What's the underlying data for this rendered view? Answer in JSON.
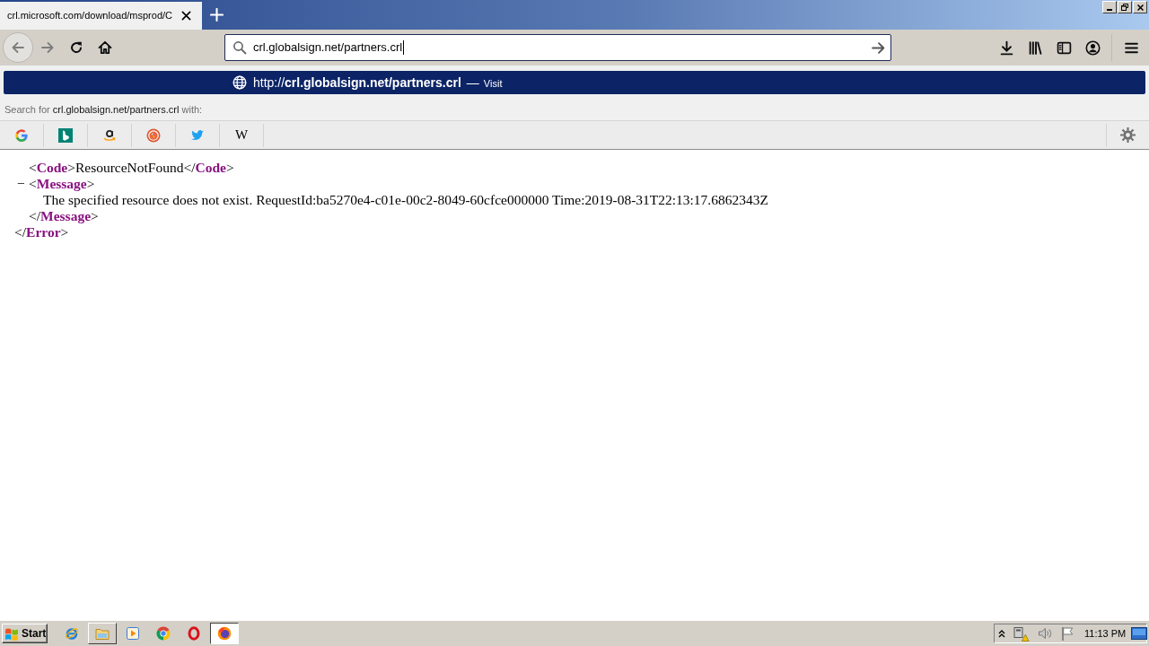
{
  "tabs": [
    {
      "label": "crl.microsoft.com/download/msprod/C",
      "selected": true
    }
  ],
  "window_controls": [
    {
      "kind": "minimize"
    },
    {
      "kind": "restore"
    },
    {
      "kind": "close"
    }
  ],
  "navigation": [
    {
      "kind": "back",
      "disabled": true
    },
    {
      "kind": "forward",
      "disabled": true
    },
    {
      "kind": "reload",
      "disabled": false
    },
    {
      "kind": "home",
      "disabled": false
    }
  ],
  "address_bar": {
    "value": "crl.globalsign.net/partners.crl",
    "focused": true
  },
  "toolbar": [
    {
      "kind": "download"
    },
    {
      "kind": "library"
    },
    {
      "kind": "sidebar"
    },
    {
      "kind": "account"
    },
    {
      "kind": "menu"
    }
  ],
  "url_dropdown": {
    "results": [
      {
        "url": "http://**crl.globalsign.net/partners.crl**",
        "separator": "—",
        "action": "Visit",
        "selected": true
      }
    ],
    "search_hint": "Search for **crl.globalsign.net/partners.crl** with:",
    "engines": [
      {
        "kind": "google"
      },
      {
        "kind": "bing"
      },
      {
        "kind": "amazon"
      },
      {
        "kind": "duckduckgo"
      },
      {
        "kind": "twitter"
      },
      {
        "kind": "wikipedia",
        "glyph": "W"
      }
    ]
  },
  "xml_tree": {
    "children": [
      {
        "line": "<**Code**>ResourceNotFound</**Code**>"
      },
      {
        "toggle": "−",
        "expanded": true,
        "open": "<**Message**>",
        "children": [
          {
            "line": "The specified resource does not exist. RequestId:ba5270e4-c01e-00c2-8049-60cfce000000 Time:2019-08-31T22:13:17.6862343Z"
          }
        ],
        "close": "</**Message**>"
      }
    ],
    "close": "</**Error**>"
  },
  "taskbar": {
    "start": {
      "label": "Start"
    },
    "apps": [
      {
        "kind": "ie",
        "running": false,
        "selected": false
      },
      {
        "kind": "explorer",
        "running": true,
        "selected": false
      },
      {
        "kind": "media",
        "running": false,
        "selected": false
      },
      {
        "kind": "chrome",
        "running": false,
        "selected": false
      },
      {
        "kind": "opera",
        "running": false,
        "selected": false
      },
      {
        "kind": "firefox",
        "running": true,
        "selected": true
      }
    ],
    "tray": [
      {
        "kind": "expand"
      },
      {
        "kind": "network"
      },
      {
        "kind": "volume"
      },
      {
        "kind": "action_center"
      },
      {
        "kind": "clock",
        "text": "11:13 PM"
      },
      {
        "kind": "show_desktop"
      }
    ]
  }
}
